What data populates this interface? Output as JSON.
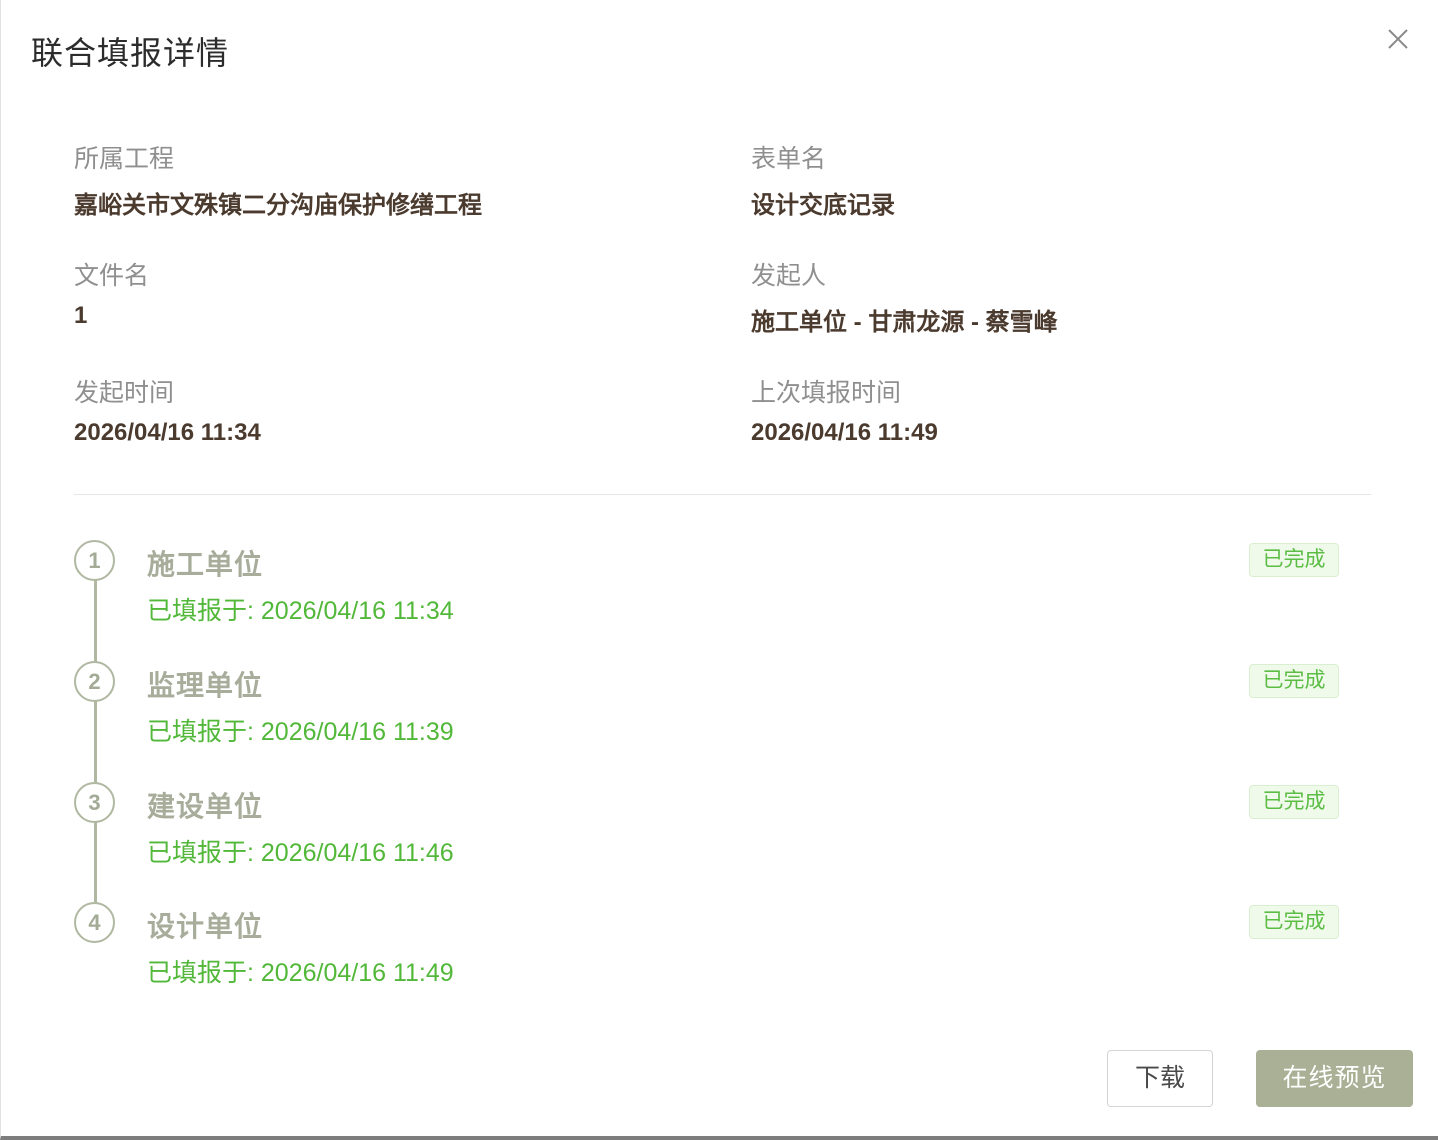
{
  "dialog": {
    "title": "联合填报详情"
  },
  "fields": {
    "project_label": "所属工程",
    "project_value": "嘉峪关市文殊镇二分沟庙保护修缮工程",
    "form_label": "表单名",
    "form_value": "设计交底记录",
    "file_label": "文件名",
    "file_value": "1",
    "initiator_label": "发起人",
    "initiator_value": "施工单位 - 甘肃龙源 - 蔡雪峰",
    "start_time_label": "发起时间",
    "start_time_value": "2026/04/16 11:34",
    "last_time_label": "上次填报时间",
    "last_time_value": "2026/04/16 11:49"
  },
  "steps": [
    {
      "index": "1",
      "name": "施工单位",
      "time": "已填报于: 2026/04/16 11:34",
      "status": "已完成"
    },
    {
      "index": "2",
      "name": "监理单位",
      "time": "已填报于: 2026/04/16 11:39",
      "status": "已完成"
    },
    {
      "index": "3",
      "name": "建设单位",
      "time": "已填报于: 2026/04/16 11:46",
      "status": "已完成"
    },
    {
      "index": "4",
      "name": "设计单位",
      "time": "已填报于: 2026/04/16 11:49",
      "status": "已完成"
    }
  ],
  "footer": {
    "download_label": "下载",
    "preview_label": "在线预览"
  },
  "icons": {
    "close": "close-icon"
  },
  "colors": {
    "accent": "#a9b095",
    "success": "#52b83a",
    "value_text": "#4b3a2e"
  }
}
